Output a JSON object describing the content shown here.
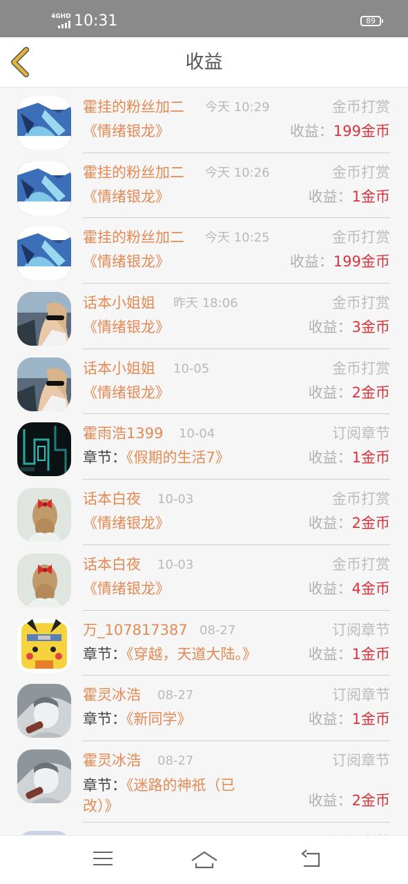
{
  "status_bar": {
    "signal": "4GHD",
    "time": "10:31",
    "battery": "89"
  },
  "header": {
    "title": "收益"
  },
  "income_label": "收益：",
  "chapter_label": "章节：",
  "items": [
    {
      "name": "霍挂的粉丝加二",
      "time": "今天 10:29",
      "type": "金币打赏",
      "book": "《情绪银龙》",
      "income": "199金币",
      "avatar": "anime-blue"
    },
    {
      "name": "霍挂的粉丝加二",
      "time": "今天 10:26",
      "type": "金币打赏",
      "book": "《情绪银龙》",
      "income": "1金币",
      "avatar": "anime-blue"
    },
    {
      "name": "霍挂的粉丝加二",
      "time": "今天 10:25",
      "type": "金币打赏",
      "book": "《情绪银龙》",
      "income": "199金币",
      "avatar": "anime-blue"
    },
    {
      "name": "话本小姐姐",
      "time": "昨天 18:06",
      "type": "金币打赏",
      "book": "《情绪银龙》",
      "income": "3金币",
      "avatar": "woman-sunglasses"
    },
    {
      "name": "话本小姐姐",
      "time": "10-05",
      "type": "金币打赏",
      "book": "《情绪银龙》",
      "income": "2金币",
      "avatar": "woman-sunglasses"
    },
    {
      "name": "霍雨浩1399",
      "time": "10-04",
      "type": "订阅章节",
      "book": "《假期的生活7》",
      "income": "1金币",
      "avatar": "dark-circuit"
    },
    {
      "name": "话本白夜",
      "time": "10-03",
      "type": "金币打赏",
      "book": "《情绪银龙》",
      "income": "2金币",
      "avatar": "hair-bow"
    },
    {
      "name": "话本白夜",
      "time": "10-03",
      "type": "金币打赏",
      "book": "《情绪银龙》",
      "income": "4金币",
      "avatar": "hair-bow"
    },
    {
      "name": "万_107817387",
      "time": "08-27",
      "type": "订阅章节",
      "book": "《穿越，天道大陆。》",
      "income": "1金币",
      "avatar": "pikachu"
    },
    {
      "name": "霍灵冰浩",
      "time": "08-27",
      "type": "订阅章节",
      "book": "《新同学》",
      "income": "1金币",
      "avatar": "anime-gray"
    },
    {
      "name": "霍灵冰浩",
      "time": "08-27",
      "type": "订阅章节",
      "book": "《迷路的神祇（已改）》",
      "income": "2金币",
      "avatar": "anime-gray"
    },
    {
      "name": "",
      "time": "",
      "type": "订阅章节",
      "book": "",
      "income": "",
      "avatar": "default"
    }
  ],
  "colors": {
    "name": "#e48a54",
    "amount": "#d8323a",
    "muted": "#b9b9b9",
    "back_arrow": "#e2b33b"
  },
  "icons": {
    "back": "chevron-left-icon",
    "menu": "menu-icon",
    "home": "home-icon",
    "back_nav": "return-icon"
  }
}
